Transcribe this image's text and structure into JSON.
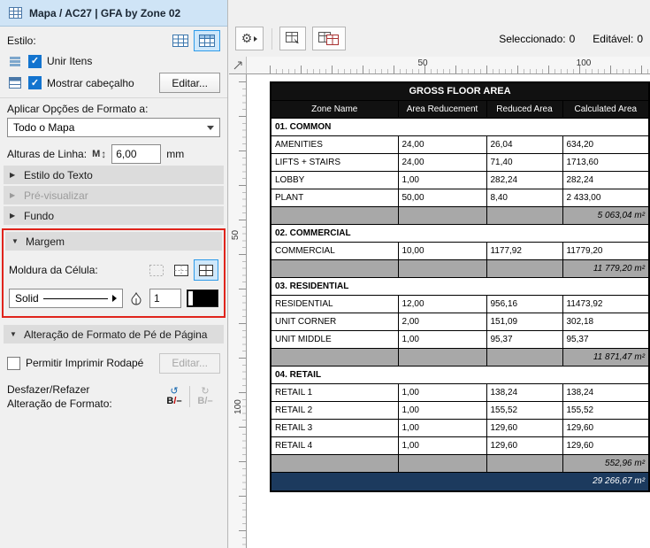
{
  "window": {
    "title": "Mapa / AC27 | GFA by Zone 02"
  },
  "left_panel": {
    "style_label": "Estilo:",
    "unify_items_label": "Unir Itens",
    "show_header_label": "Mostrar cabeçalho",
    "edit_button_label": "Editar...",
    "apply_format_label": "Aplicar Opções de Formato a:",
    "apply_format_value": "Todo o Mapa",
    "row_heights_label": "Alturas de Linha:",
    "row_heights_value": "6,00",
    "row_heights_unit": "mm",
    "section_text_style": "Estilo do Texto",
    "section_preview": "Pré-visualizar",
    "section_background": "Fundo",
    "section_margin": "Margem",
    "cell_border_label": "Moldura da Célula:",
    "line_type_value": "Solid",
    "pen_weight_value": "1",
    "section_footer_format": "Alteração de Formato de Pé de Página",
    "allow_print_footer_label": "Permitir Imprimir Rodapé",
    "footer_edit_button_label": "Editar...",
    "undo_redo_label_line1": "Desfazer/Refazer",
    "undo_redo_label_line2": "Alteração de Formato:",
    "checkbox_states": {
      "unify_items": true,
      "show_header": true,
      "allow_print_footer": false
    }
  },
  "right_panel": {
    "selected_label": "Seleccionado:",
    "selected_value": "0",
    "editable_label": "Editável:",
    "editable_value": "0",
    "ruler_h": [
      "50",
      "100"
    ],
    "ruler_v": [
      "50",
      "100"
    ]
  },
  "table": {
    "title": "GROSS FLOOR AREA",
    "columns": [
      "Zone Name",
      "Area Reducement",
      "Reduced Area",
      "Calculated Area"
    ],
    "sections": [
      {
        "name": "01. COMMON",
        "rows": [
          [
            "AMENITIES",
            "24,00",
            "26,04",
            "634,20"
          ],
          [
            "LIFTS + STAIRS",
            "24,00",
            "71,40",
            "1713,60"
          ],
          [
            "LOBBY",
            "1,00",
            "282,24",
            "282,24"
          ],
          [
            "PLANT",
            "50,00",
            "8,40",
            "2 433,00"
          ]
        ],
        "subtotal": "5 063,04 m²"
      },
      {
        "name": "02. COMMERCIAL",
        "rows": [
          [
            "COMMERCIAL",
            "10,00",
            "1177,92",
            "11779,20"
          ]
        ],
        "subtotal": "11 779,20 m²"
      },
      {
        "name": "03. RESIDENTIAL",
        "rows": [
          [
            "RESIDENTIAL",
            "12,00",
            "956,16",
            "11473,92"
          ],
          [
            "UNIT CORNER",
            "2,00",
            "151,09",
            "302,18"
          ],
          [
            "UNIT MIDDLE",
            "1,00",
            "95,37",
            "95,37"
          ]
        ],
        "subtotal": "11 871,47 m²"
      },
      {
        "name": "04. RETAIL",
        "rows": [
          [
            "RETAIL 1",
            "1,00",
            "138,24",
            "138,24"
          ],
          [
            "RETAIL 2",
            "1,00",
            "155,52",
            "155,52"
          ],
          [
            "RETAIL 3",
            "1,00",
            "129,60",
            "129,60"
          ],
          [
            "RETAIL 4",
            "1,00",
            "129,60",
            "129,60"
          ]
        ],
        "subtotal": "552,96 m²"
      }
    ],
    "grand_total": "29 266,67 m²"
  },
  "colors": {
    "titlebar_bg": "#cfe4f6",
    "selection_blue": "#2e9be9",
    "selection_bg": "#cfe8fb",
    "checkbox_blue": "#1374cf",
    "highlight_red": "#e0241c",
    "table_header_bg": "#111111",
    "subtotal_bg": "#a8a8a8",
    "total_bg": "#1c3a5e"
  }
}
